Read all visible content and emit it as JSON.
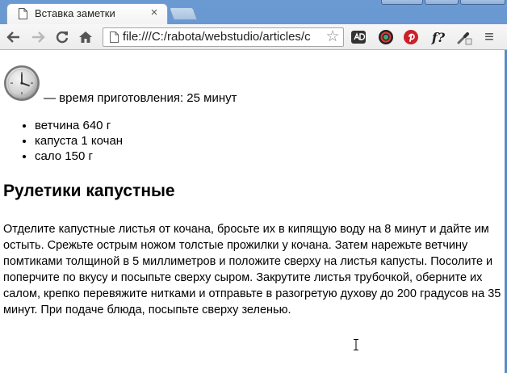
{
  "tab": {
    "title": "Вставка заметки",
    "close": "×"
  },
  "toolbar": {
    "url": "file:///C:/rabota/webstudio/articles/c",
    "star": "☆",
    "ext_f_label": "f?",
    "menu": "≡"
  },
  "page": {
    "cook_time": "— время приготовления: 25 минут",
    "ingredients": [
      "ветчина 640 г",
      "капуста 1 кочан",
      "сало 150 г"
    ],
    "title": "Рулетики капустные",
    "instructions": "Отделите капустные листья от кочана, бросьте их в кипящую воду на 8 минут и дайте им остыть. Срежьте острым ножом толстые прожилки у кочана. Затем нарежьте ветчину помтиками толщиной в 5 миллиметров и положите сверху на листья капусты. Посолите и поперчите по вкусу и посыпьте сверху сыром. Закрутите листья трубочкой, оберните их салом, крепко перевяжите нитками и отправьте в разогретую духову до 200 градусов на 35 минут. При подаче блюда, посыпьте сверху зеленью."
  },
  "colors": {
    "frame": "#5a8bc6",
    "pinterest": "#cb2027",
    "toolbar": "#ececec"
  },
  "icons": [
    "page-icon",
    "back-arrow-icon",
    "forward-arrow-icon",
    "reload-icon",
    "home-icon",
    "bookmark-star-icon",
    "extension-ad-icon",
    "extension-color-icon",
    "pinterest-icon",
    "extension-f-icon",
    "eyedropper-icon",
    "menu-icon",
    "clock-icon"
  ]
}
